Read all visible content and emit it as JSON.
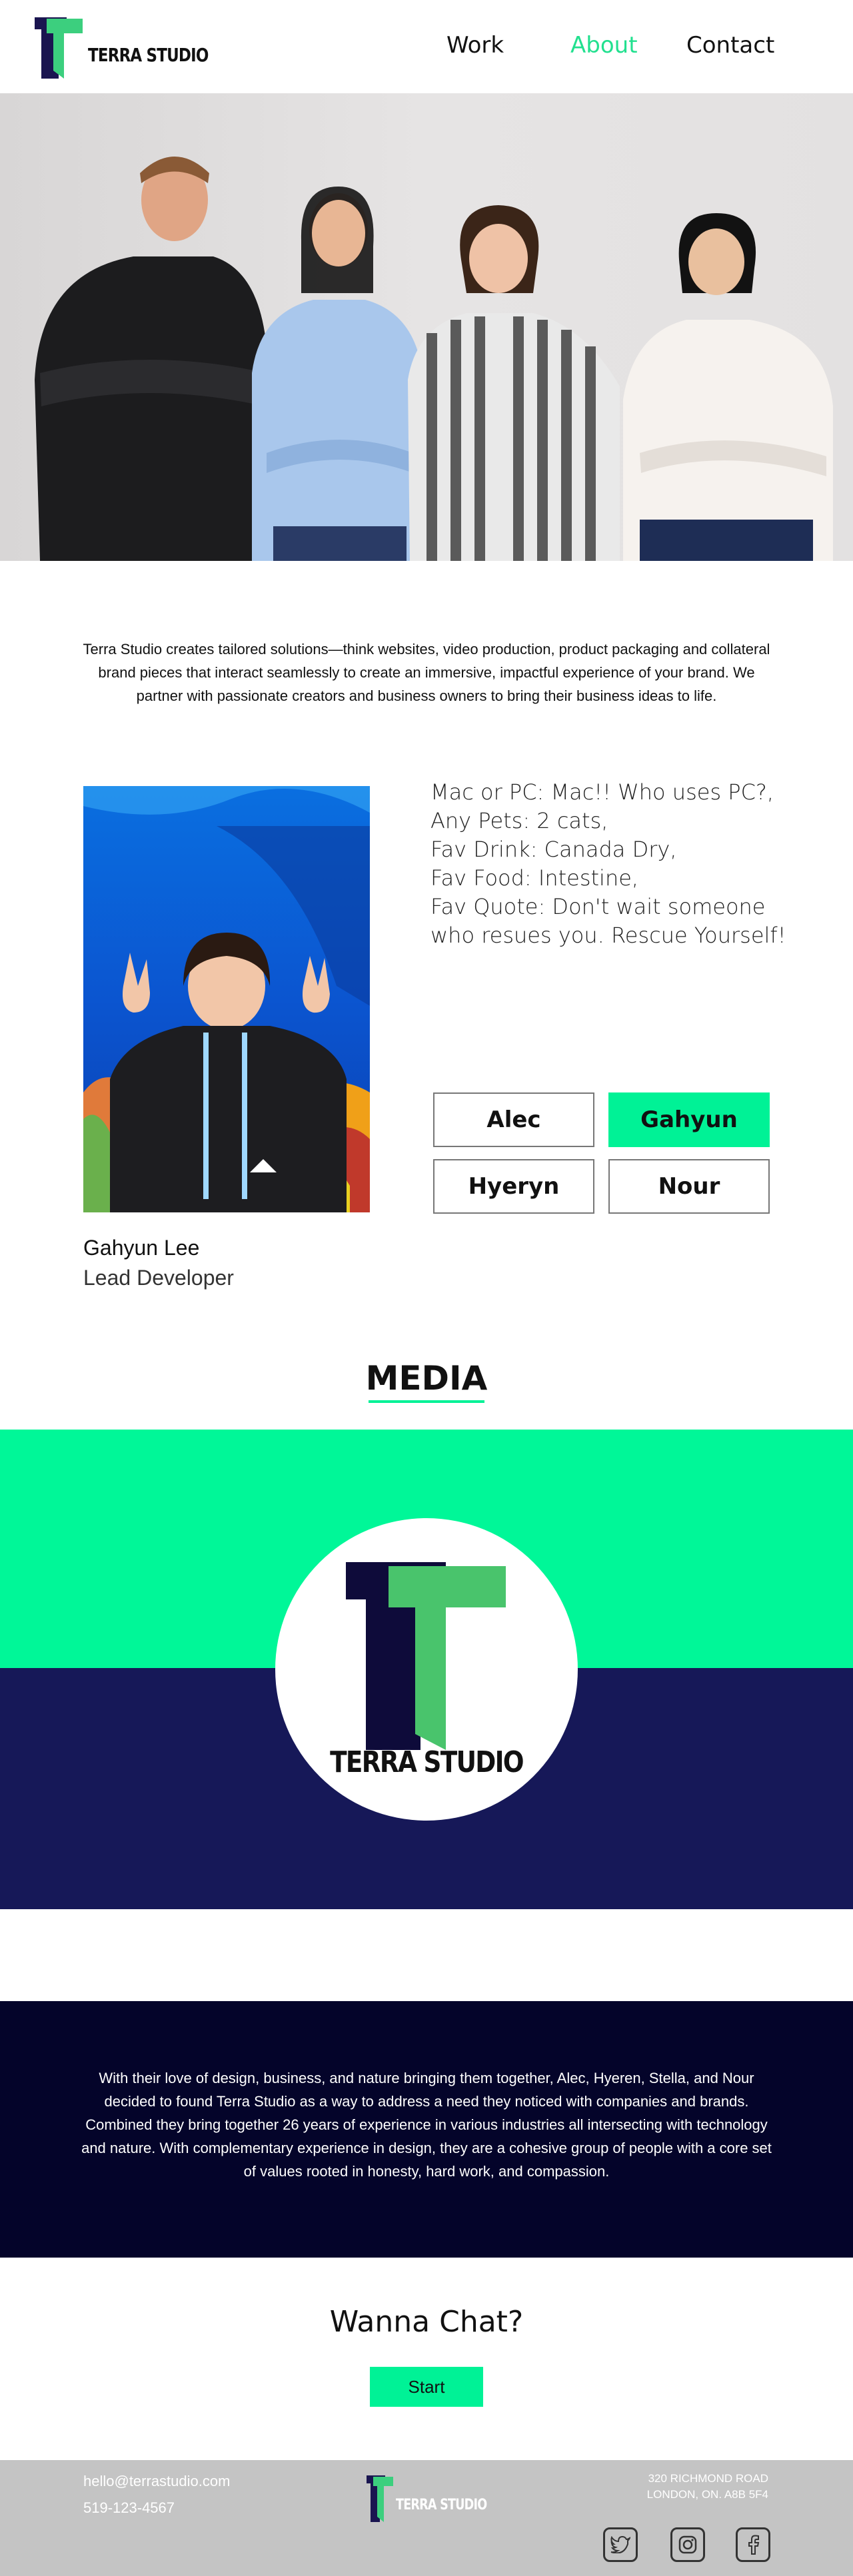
{
  "header": {
    "brand": "TERRA STUDIO",
    "nav": [
      {
        "label": "Work"
      },
      {
        "label": "About"
      },
      {
        "label": "Contact"
      }
    ]
  },
  "intro": "Terra Studio creates tailored solutions—think websites, video production, product packaging and collateral brand pieces that interact seamlessly to create an immersive, impactful experience of your brand. We partner with passionate creators and business owners to bring their business ideas to life.",
  "profile": {
    "facts": [
      "Mac or PC: Mac!! Who uses PC?,",
      "Any Pets: 2 cats,",
      "Fav Drink: Canada Dry,",
      "Fav Food: Intestine,",
      "Fav Quote: Don't wait someone who resues you. Rescue Yourself!"
    ],
    "name": "Gahyun Lee",
    "role": "Lead Developer",
    "team_buttons": [
      "Alec",
      "Gahyun",
      "Hyeryn",
      "Nour"
    ],
    "selected": "Gahyun"
  },
  "media": {
    "title": "MEDIA",
    "logo_text": "TERRA STUDIO"
  },
  "about": "With their love of design, business, and nature bringing them together, Alec, Hyeren, Stella, and Nour decided to found Terra Studio as a way to address a need they noticed with companies and brands. Combined they bring together 26 years of experience in various industries all intersecting with technology and nature. With complementary experience in design, they are a cohesive group of people with a core set of values rooted in honesty, hard work, and compassion.",
  "chat": {
    "title": "Wanna Chat?",
    "button": "Start"
  },
  "footer": {
    "email": "hello@terrastudio.com",
    "phone": "519-123-4567",
    "brand": "TERRA STUDIO",
    "address_line1": "320 RICHMOND ROAD",
    "address_line2": "LONDON, ON. A8B 5F4",
    "social": [
      "twitter-icon",
      "instagram-icon",
      "facebook-icon"
    ]
  },
  "colors": {
    "accent": "#00f296",
    "navy": "#161858",
    "dark": "#04042a",
    "footer": "#c4c4c4"
  }
}
